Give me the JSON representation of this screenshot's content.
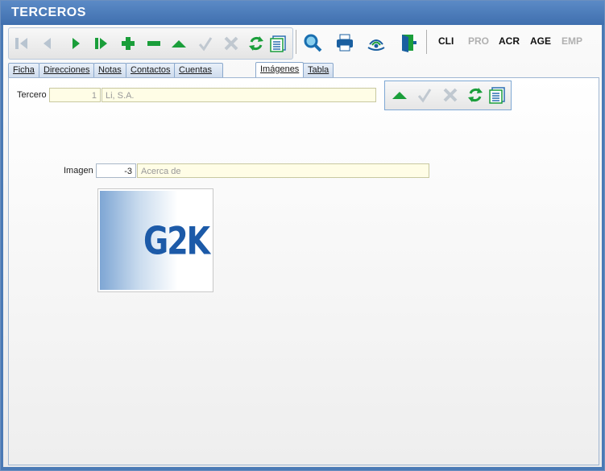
{
  "window": {
    "title": "TERCEROS"
  },
  "toolbar": {
    "nav_icons": [
      "first-icon",
      "prev-icon",
      "next-icon",
      "last-icon",
      "add-icon",
      "remove-icon",
      "up-icon",
      "check-icon",
      "cancel-icon",
      "refresh-icon",
      "list-icon"
    ],
    "tool_icons": [
      "search-icon",
      "print-icon",
      "signal-icon",
      "exit-door-icon"
    ],
    "text_buttons": [
      {
        "label": "CLI",
        "enabled": true
      },
      {
        "label": "PRO",
        "enabled": false
      },
      {
        "label": "ACR",
        "enabled": true
      },
      {
        "label": "AGE",
        "enabled": true
      },
      {
        "label": "EMP",
        "enabled": false
      }
    ]
  },
  "tabs": [
    {
      "label": "Ficha"
    },
    {
      "label": "Direcciones"
    },
    {
      "label": "Notas"
    },
    {
      "label": "Contactos"
    },
    {
      "label": "Cuentas Bancarias"
    },
    {
      "label": "Imágenes"
    },
    {
      "label": "Tabla"
    }
  ],
  "active_tab": "Imágenes",
  "form": {
    "tercero_label": "Tercero",
    "tercero_id": "1",
    "tercero_name": "Li, S.A.",
    "imagen_label": "Imagen",
    "imagen_id": "-3",
    "imagen_desc": "Acerca de"
  },
  "image": {
    "logo_text": "G2K"
  },
  "colors": {
    "accent": "#3f6fae",
    "green": "#1a9e3a",
    "field_bg": "#fffde6"
  }
}
